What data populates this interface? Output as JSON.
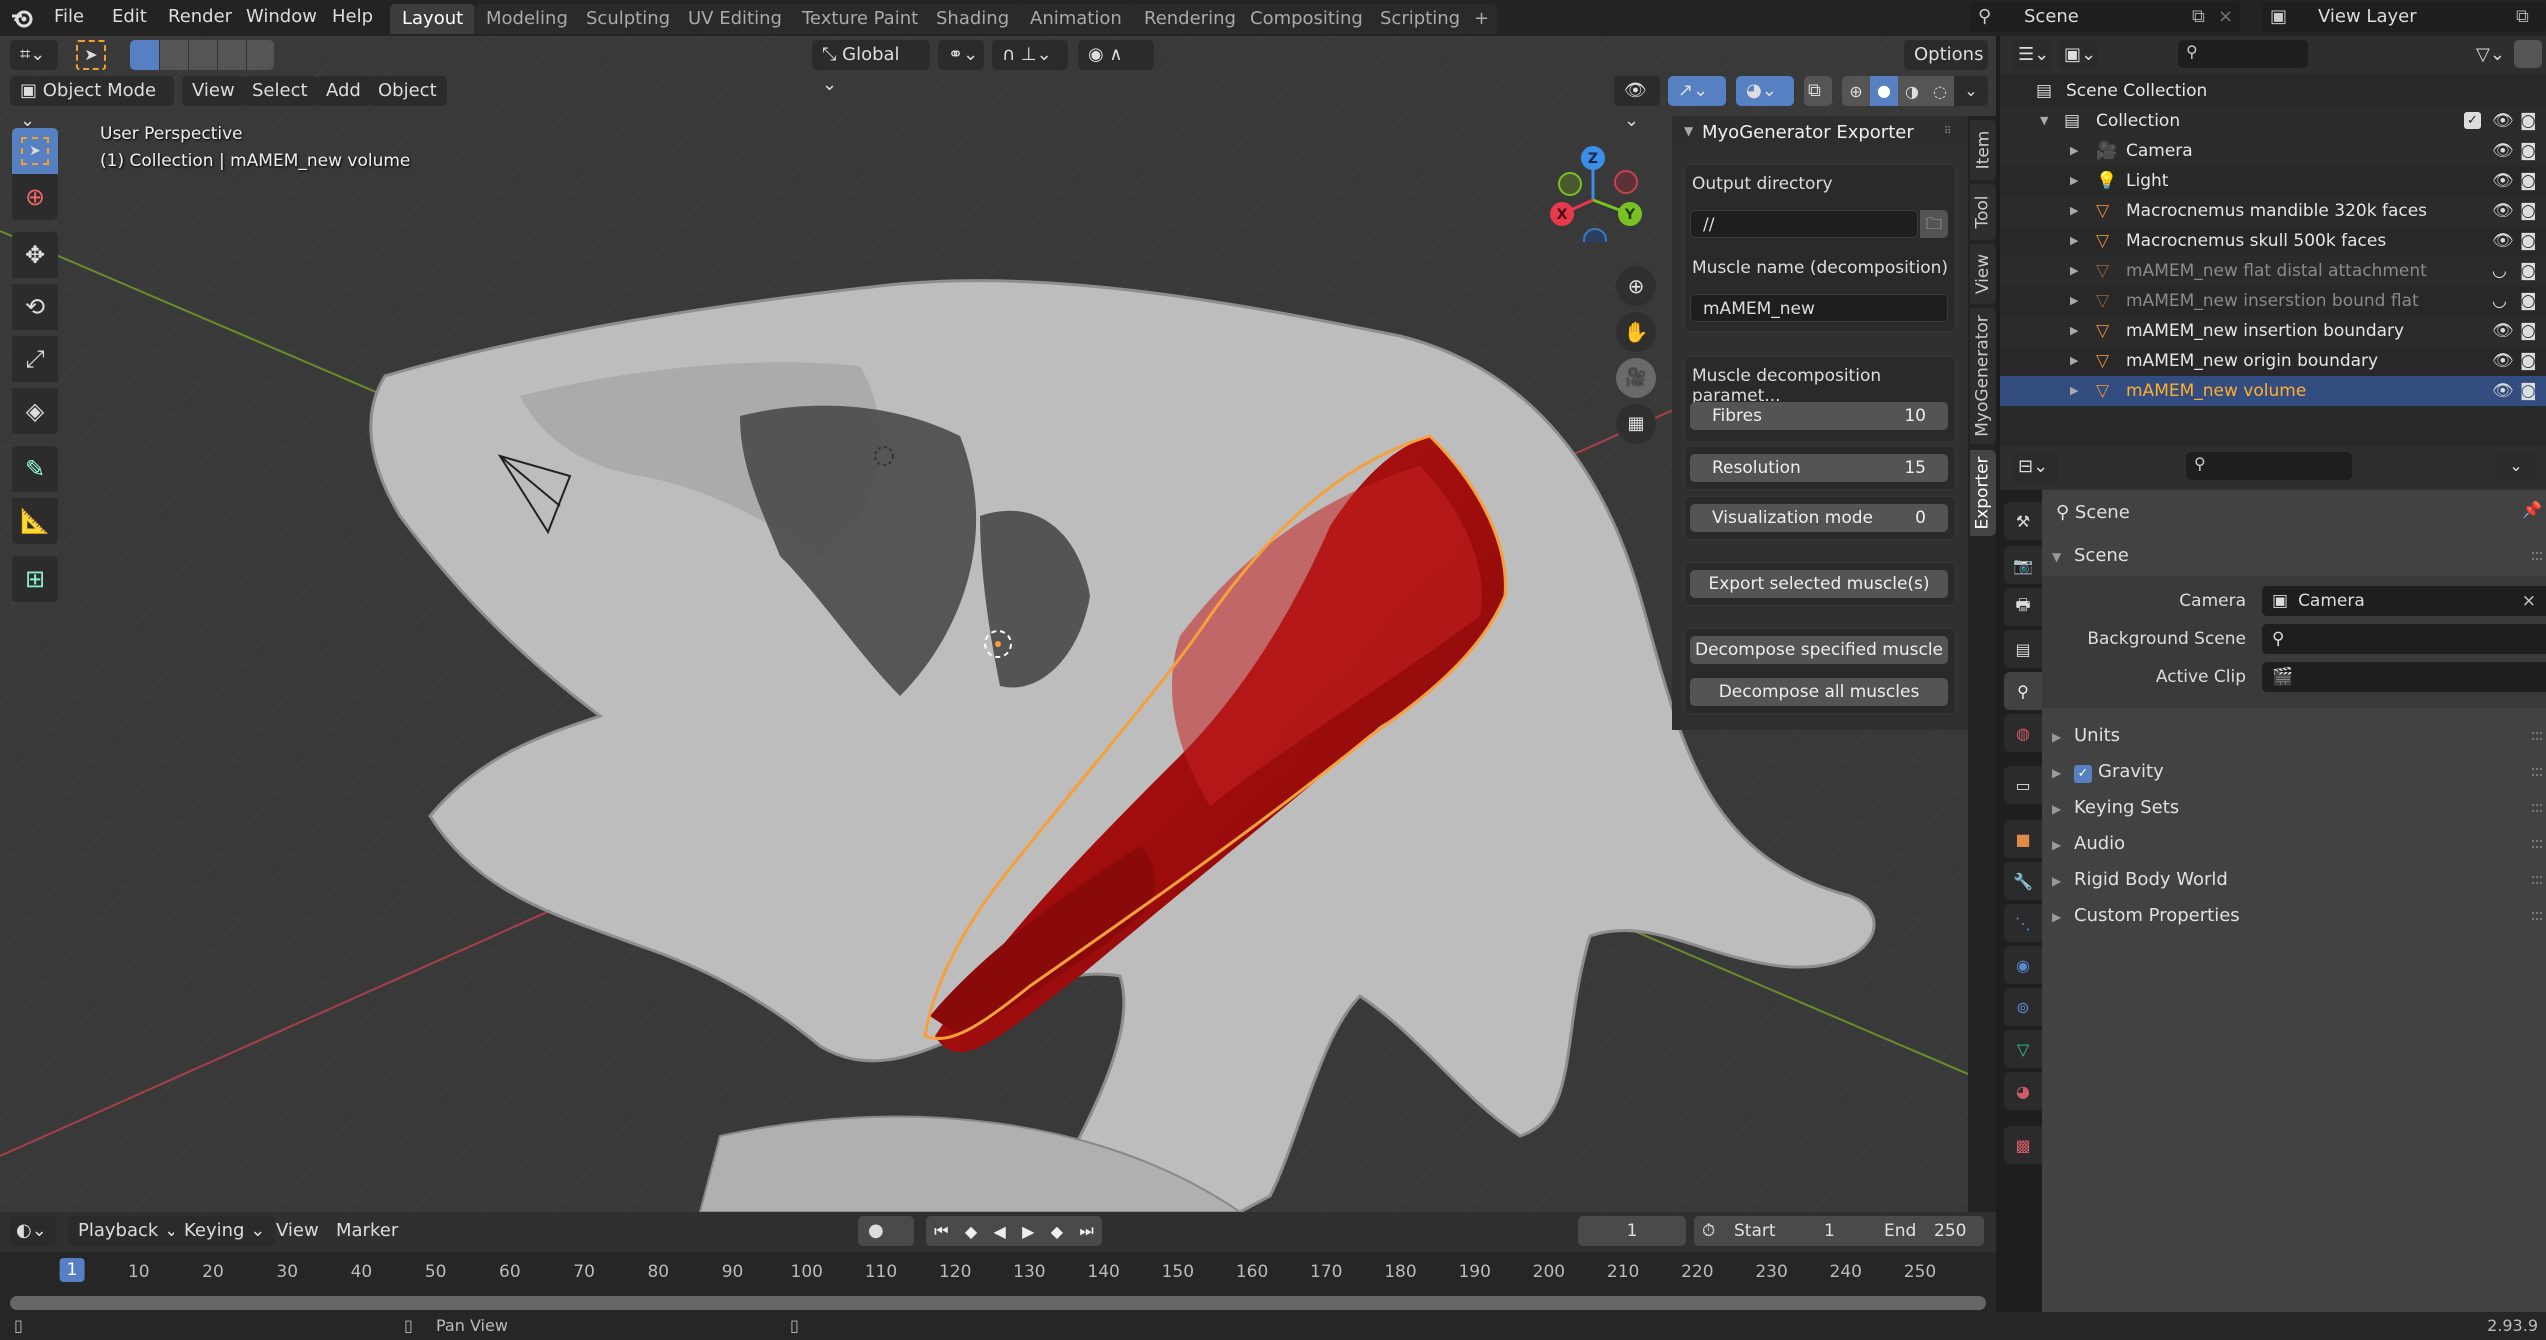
{
  "app": {
    "version": "2.93.9"
  },
  "menu": [
    "File",
    "Edit",
    "Render",
    "Window",
    "Help"
  ],
  "workspaces": [
    "Layout",
    "Modeling",
    "Sculpting",
    "UV Editing",
    "Texture Paint",
    "Shading",
    "Animation",
    "Rendering",
    "Compositing",
    "Scripting"
  ],
  "workspace_active": "Layout",
  "add_workspace": "+",
  "scene_selector": {
    "value": "Scene"
  },
  "viewlayer_selector": {
    "value": "View Layer"
  },
  "viewport": {
    "mode": "Object Mode",
    "menus": [
      "View",
      "Select",
      "Add",
      "Object"
    ],
    "orientation": "Global",
    "options_label": "Options",
    "overlay_title": "User Perspective",
    "overlay_subtitle": "(1) Collection | mAMEM_new volume",
    "gizmo": {
      "x": "X",
      "y": "Y",
      "z": "Z"
    },
    "colors": {
      "muscle": "#a40d0d",
      "selection_outline": "#f5a03a",
      "bone": "#c8c8c8"
    }
  },
  "tools": [
    "select-box",
    "cursor",
    "move",
    "rotate",
    "scale",
    "transform",
    "annotate",
    "measure",
    "add-cube"
  ],
  "npanel": {
    "title": "MyoGenerator Exporter",
    "output_dir_label": "Output directory",
    "output_dir_value": "//",
    "muscle_name_label": "Muscle name (decomposition)",
    "muscle_name_value": "mAMEM_new",
    "params_label": "Muscle decomposition paramet...",
    "fibres_label": "Fibres",
    "fibres_value": "10",
    "resolution_label": "Resolution",
    "resolution_value": "15",
    "vis_label": "Visualization mode",
    "vis_value": "0",
    "export_btn": "Export selected muscle(s)",
    "decompose_btn": "Decompose specified muscle",
    "decompose_all_btn": "Decompose all muscles",
    "tabs": [
      "Item",
      "Tool",
      "View",
      "MyoGenerator",
      "Exporter"
    ],
    "active_tab": "Exporter"
  },
  "outliner": {
    "root": "Scene Collection",
    "collection": "Collection",
    "items": [
      {
        "name": "Camera",
        "type": "camera",
        "visible": true,
        "dim": false,
        "selected": false
      },
      {
        "name": "Light",
        "type": "light",
        "visible": true,
        "dim": false,
        "selected": false
      },
      {
        "name": "Macrocnemus mandible 320k faces",
        "type": "mesh",
        "visible": true,
        "dim": false,
        "selected": false
      },
      {
        "name": "Macrocnemus skull 500k faces",
        "type": "mesh",
        "visible": true,
        "dim": false,
        "selected": false
      },
      {
        "name": "mAMEM_new  flat distal attachment",
        "type": "mesh",
        "visible": false,
        "dim": true,
        "selected": false
      },
      {
        "name": "mAMEM_new inserstion bound flat",
        "type": "mesh",
        "visible": false,
        "dim": true,
        "selected": false
      },
      {
        "name": "mAMEM_new insertion boundary",
        "type": "mesh",
        "visible": true,
        "dim": false,
        "selected": false
      },
      {
        "name": "mAMEM_new origin boundary",
        "type": "mesh",
        "visible": true,
        "dim": false,
        "selected": false
      },
      {
        "name": "mAMEM_new volume",
        "type": "mesh",
        "visible": true,
        "dim": false,
        "selected": true
      }
    ]
  },
  "properties": {
    "context": "Scene",
    "section": "Scene",
    "camera_label": "Camera",
    "camera_value": "Camera",
    "bg_scene_label": "Background Scene",
    "bg_scene_value": "",
    "active_clip_label": "Active Clip",
    "active_clip_value": "",
    "subsections": [
      {
        "label": "Units",
        "checkbox": false
      },
      {
        "label": "Gravity",
        "checkbox": true,
        "checked": true
      },
      {
        "label": "Keying Sets",
        "checkbox": false
      },
      {
        "label": "Audio",
        "checkbox": false
      },
      {
        "label": "Rigid Body World",
        "checkbox": false
      },
      {
        "label": "Custom Properties",
        "checkbox": false
      }
    ]
  },
  "timeline": {
    "menus": [
      "Playback",
      "Keying",
      "View",
      "Marker"
    ],
    "current_frame": "1",
    "start_label": "Start",
    "start": "1",
    "end_label": "End",
    "end": "250",
    "ticks": [
      "1",
      "10",
      "20",
      "30",
      "40",
      "50",
      "60",
      "70",
      "80",
      "90",
      "100",
      "110",
      "120",
      "130",
      "140",
      "150",
      "160",
      "170",
      "180",
      "190",
      "200",
      "210",
      "220",
      "230",
      "240",
      "250"
    ]
  },
  "status": {
    "middle": "Pan View"
  }
}
